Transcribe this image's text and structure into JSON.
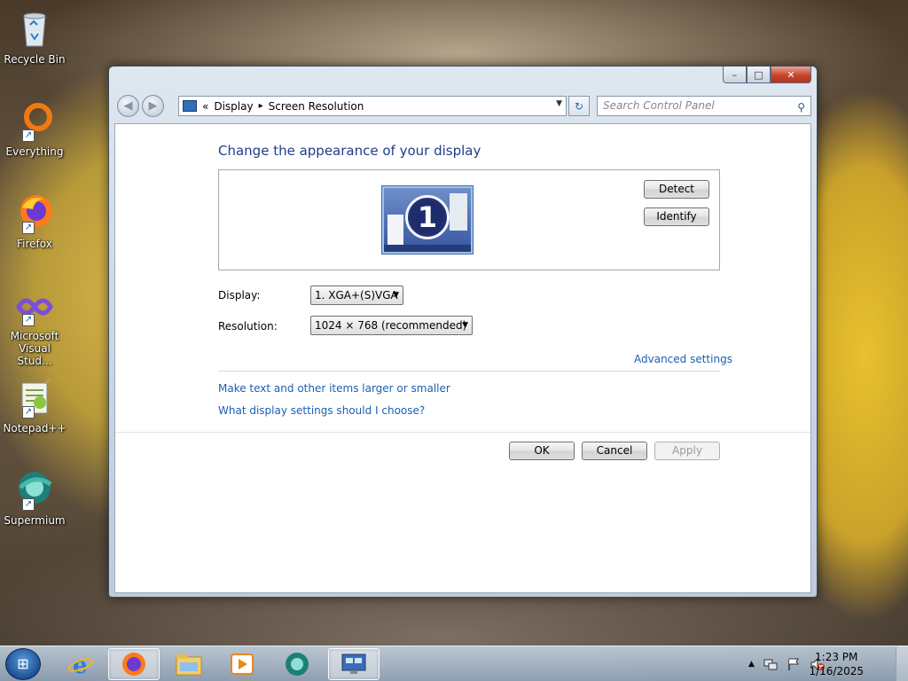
{
  "desktop": {
    "icons": [
      {
        "label": "Recycle Bin"
      },
      {
        "label": "Everything"
      },
      {
        "label": "Firefox"
      },
      {
        "label": "Microsoft Visual Stud..."
      },
      {
        "label": "Notepad++"
      },
      {
        "label": "Supermium"
      }
    ]
  },
  "window": {
    "caption": {
      "minimize": "–",
      "maximize": "□",
      "close": "✕"
    },
    "nav": {
      "back": "◀",
      "forward": "▶"
    },
    "address": {
      "prefix": "«",
      "crumb1": "Display",
      "sep": "▸",
      "crumb2": "Screen Resolution",
      "dropdown": "▼"
    },
    "refresh": "↻",
    "search_placeholder": "Search Control Panel",
    "search_glyph": "⚲",
    "heading": "Change the appearance of your display",
    "monitor_number": "1",
    "detect_label": "Detect",
    "identify_label": "Identify",
    "display_label": "Display:",
    "display_value": "1. XGA+(S)VGA",
    "resolution_label": "Resolution:",
    "resolution_value": "1024 × 768 (recommended)",
    "combo_arrow": "▼",
    "advanced_link": "Advanced settings",
    "link_text_size": "Make text and other items larger or smaller",
    "link_help": "What display settings should I choose?",
    "ok_label": "OK",
    "cancel_label": "Cancel",
    "apply_label": "Apply"
  },
  "taskbar": {
    "start_glyph": "⊞",
    "tray_expand": "▲",
    "clock_time": "1:23 PM",
    "clock_date": "1/16/2025"
  },
  "colors": {
    "link": "#1a5fb4",
    "heading": "#1e3f8a"
  }
}
